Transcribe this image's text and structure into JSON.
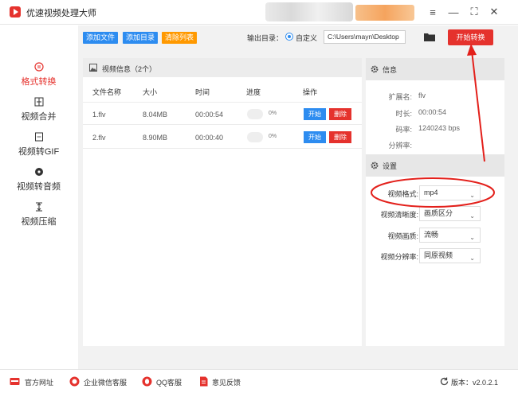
{
  "app": {
    "title": "优速视频处理大师"
  },
  "window": {
    "menu_glyph": "≡",
    "min_glyph": "—",
    "max_glyph": "⛶",
    "close_glyph": "✕"
  },
  "sidebar": {
    "items": [
      {
        "label": "格式转换",
        "icon": "format-convert-icon",
        "active": true
      },
      {
        "label": "视频合并",
        "icon": "merge-icon"
      },
      {
        "label": "视频转GIF",
        "icon": "gif-icon"
      },
      {
        "label": "视频转音频",
        "icon": "audio-icon"
      },
      {
        "label": "视频压缩",
        "icon": "compress-icon"
      }
    ]
  },
  "toolbar": {
    "add_file": "添加文件",
    "add_folder": "添加目录",
    "clear_list": "清除列表",
    "output_label": "输出目录：",
    "custom_label": "自定义",
    "output_path": "C:\\Users\\mayn\\Desktop",
    "start_convert": "开始转换"
  },
  "file_list": {
    "title": "视频信息（2个）",
    "columns": [
      "文件名称",
      "大小",
      "时间",
      "进度",
      "操作"
    ],
    "rows": [
      {
        "name": "1.flv",
        "size": "8.04MB",
        "time": "00:00:54",
        "progress": "0%",
        "start": "开始",
        "delete": "删除"
      },
      {
        "name": "2.flv",
        "size": "8.90MB",
        "time": "00:00:40",
        "progress": "0%",
        "start": "开始",
        "delete": "删除"
      }
    ]
  },
  "info": {
    "title": "信息",
    "ext_label": "扩展名:",
    "ext_value": "flv",
    "duration_label": "时长:",
    "duration_value": "00:00:54",
    "bitrate_label": "码率:",
    "bitrate_value": "1240243 bps",
    "resolution_label": "分辨率:",
    "resolution_value": ""
  },
  "settings": {
    "title": "设置",
    "format_label": "视频格式:",
    "format_value": "mp4",
    "clarity_label": "视频清晰度:",
    "clarity_value": "画质区分",
    "quality_label": "视频画质:",
    "quality_value": "流畅",
    "resolution_label": "视频分辨率:",
    "resolution_value": "同原视频"
  },
  "footer": {
    "website": "官方网址",
    "wechat": "企业微信客服",
    "qq": "QQ客服",
    "feedback": "意见反馈",
    "version": "版本：v2.0.2.1"
  },
  "colors": {
    "accent_red": "#e5322d",
    "button_blue": "#2d8cf0",
    "button_orange": "#ff9900",
    "annotation": "#e3201b"
  }
}
